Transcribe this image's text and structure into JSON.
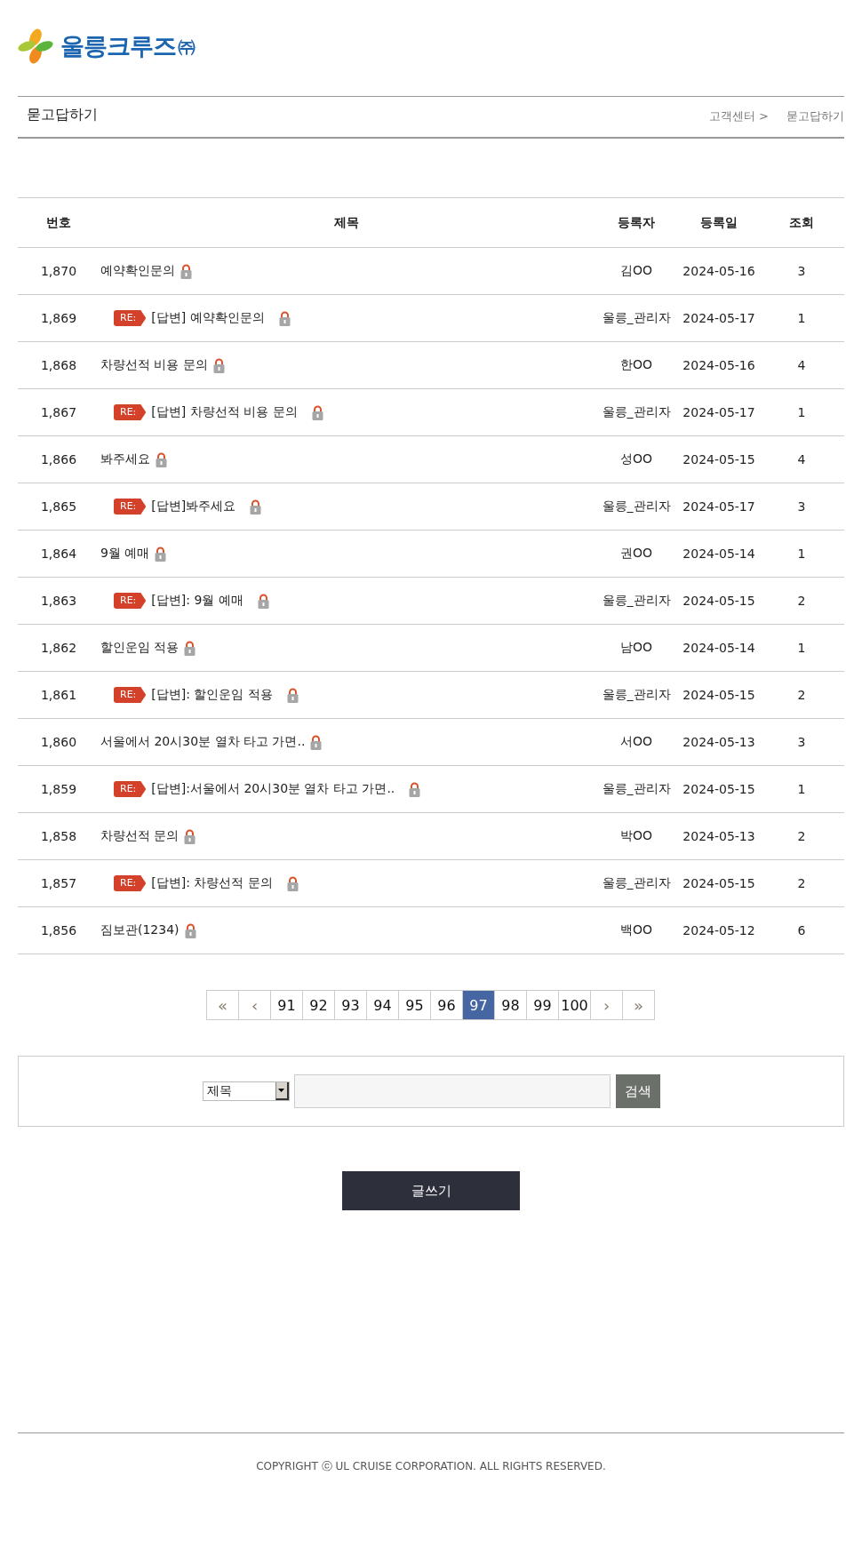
{
  "logo": {
    "name": "울릉크루즈",
    "suffix": "㈜"
  },
  "page_header": {
    "title": "묻고답하기",
    "breadcrumb": [
      "고객센터 >",
      "묻고답하기"
    ]
  },
  "table": {
    "columns": [
      "번호",
      "제목",
      "등록자",
      "등록일",
      "조회"
    ],
    "rows": [
      {
        "kind": "question",
        "number": "1,870",
        "title": "예약확인문의",
        "locked": true,
        "author": "김OO",
        "date": "2024-05-16",
        "views": "3"
      },
      {
        "kind": "answer",
        "number": "1,869",
        "badge": "RE:",
        "title": "[답변] 예약확인문의",
        "locked": true,
        "author": "울릉_관리자",
        "date": "2024-05-17",
        "views": "1"
      },
      {
        "kind": "question",
        "number": "1,868",
        "title": "차량선적 비용 문의",
        "locked": true,
        "author": "한OO",
        "date": "2024-05-16",
        "views": "4"
      },
      {
        "kind": "answer",
        "number": "1,867",
        "badge": "RE:",
        "title": "[답변] 차량선적 비용 문의",
        "locked": true,
        "author": "울릉_관리자",
        "date": "2024-05-17",
        "views": "1"
      },
      {
        "kind": "question",
        "number": "1,866",
        "title": "봐주세요",
        "locked": true,
        "author": "성OO",
        "date": "2024-05-15",
        "views": "4"
      },
      {
        "kind": "answer",
        "number": "1,865",
        "badge": "RE:",
        "title": "[답변]봐주세요",
        "locked": true,
        "author": "울릉_관리자",
        "date": "2024-05-17",
        "views": "3"
      },
      {
        "kind": "question",
        "number": "1,864",
        "title": "9월 예매",
        "locked": true,
        "author": "권OO",
        "date": "2024-05-14",
        "views": "1"
      },
      {
        "kind": "answer",
        "number": "1,863",
        "badge": "RE:",
        "title": "[답변]: 9월 예매",
        "locked": true,
        "author": "울릉_관리자",
        "date": "2024-05-15",
        "views": "2"
      },
      {
        "kind": "question",
        "number": "1,862",
        "title": "할인운임 적용",
        "locked": true,
        "author": "남OO",
        "date": "2024-05-14",
        "views": "1"
      },
      {
        "kind": "answer",
        "number": "1,861",
        "badge": "RE:",
        "title": "[답변]: 할인운임 적용",
        "locked": true,
        "author": "울릉_관리자",
        "date": "2024-05-15",
        "views": "2"
      },
      {
        "kind": "question",
        "number": "1,860",
        "title": "서울에서 20시30분 열차 타고 가면..",
        "locked": true,
        "author": "서OO",
        "date": "2024-05-13",
        "views": "3"
      },
      {
        "kind": "answer",
        "number": "1,859",
        "badge": "RE:",
        "title": "[답변]:서울에서 20시30분 열차 타고 가면..",
        "locked": true,
        "author": "울릉_관리자",
        "date": "2024-05-15",
        "views": "1"
      },
      {
        "kind": "question",
        "number": "1,858",
        "title": "차량선적 문의",
        "locked": true,
        "author": "박OO",
        "date": "2024-05-13",
        "views": "2"
      },
      {
        "kind": "answer",
        "number": "1,857",
        "badge": "RE:",
        "title": "[답변]: 차량선적 문의",
        "locked": true,
        "author": "울릉_관리자",
        "date": "2024-05-15",
        "views": "2"
      },
      {
        "kind": "question",
        "number": "1,856",
        "title": "짐보관(1234)",
        "locked": true,
        "author": "백OO",
        "date": "2024-05-12",
        "views": "6"
      }
    ]
  },
  "pagination": [
    {
      "kind": "nav",
      "label": "«",
      "selected": false
    },
    {
      "kind": "nav",
      "label": "‹",
      "selected": false
    },
    {
      "kind": "page",
      "label": "91",
      "selected": false
    },
    {
      "kind": "page",
      "label": "92",
      "selected": false
    },
    {
      "kind": "page",
      "label": "93",
      "selected": false
    },
    {
      "kind": "page",
      "label": "94",
      "selected": false
    },
    {
      "kind": "page",
      "label": "95",
      "selected": false
    },
    {
      "kind": "page",
      "label": "96",
      "selected": false
    },
    {
      "kind": "page",
      "label": "97",
      "selected": true
    },
    {
      "kind": "page",
      "label": "98",
      "selected": false
    },
    {
      "kind": "page",
      "label": "99",
      "selected": false
    },
    {
      "kind": "page",
      "label": "100",
      "selected": false
    },
    {
      "kind": "nav",
      "label": "›",
      "selected": false
    },
    {
      "kind": "nav",
      "label": "»",
      "selected": false
    }
  ],
  "search": {
    "field_select": "제목",
    "button": "검색"
  },
  "write_button": "글쓰기",
  "footer": {
    "copyright": "COPYRIGHT ⓒ UL CRUISE CORPORATION. ALL RIGHTS RESERVED."
  }
}
